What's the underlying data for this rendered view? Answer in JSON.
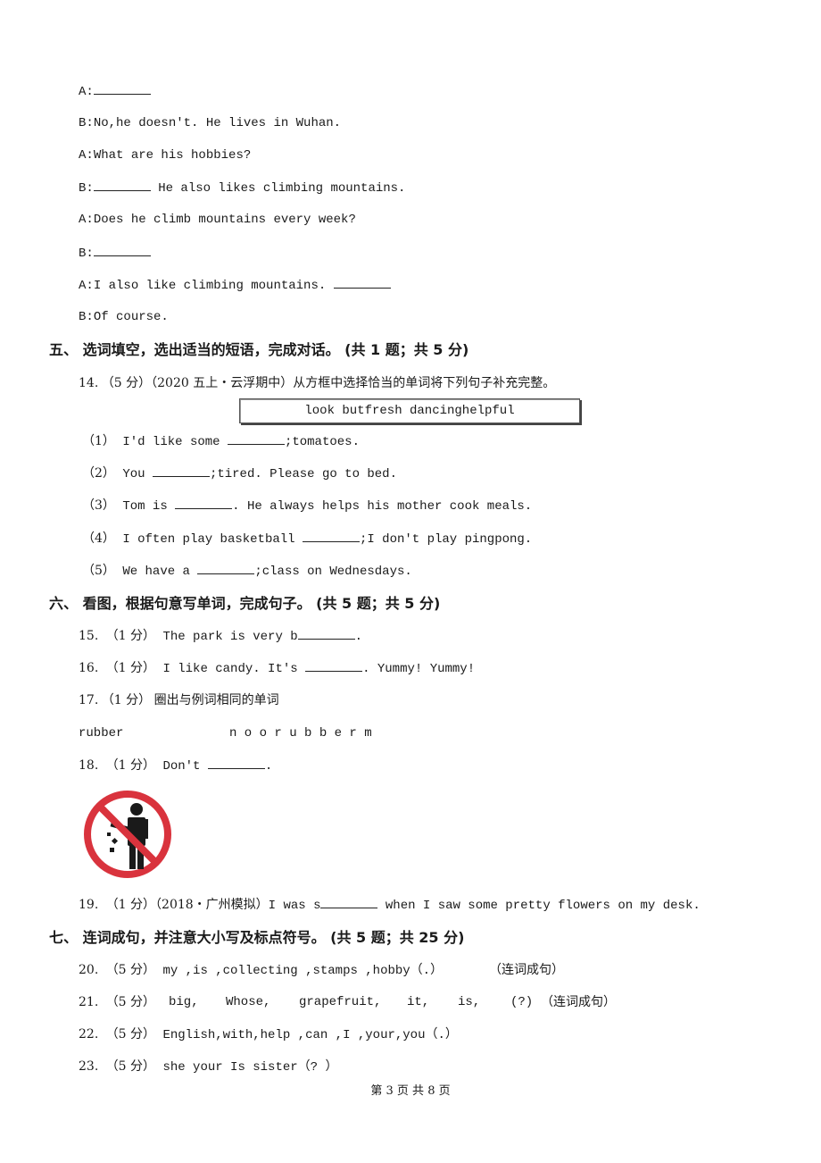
{
  "dialogue": [
    {
      "speaker": "A:",
      "before": "",
      "blank": true,
      "after": ""
    },
    {
      "speaker": "B:",
      "before": "No,he doesn't. He lives in Wuhan.",
      "blank": false,
      "after": ""
    },
    {
      "speaker": "A:",
      "before": "What are his hobbies?",
      "blank": false,
      "after": ""
    },
    {
      "speaker": "B:",
      "before": "",
      "blank": true,
      "after": " He also likes climbing mountains."
    },
    {
      "speaker": "A:",
      "before": "Does he climb mountains every week?",
      "blank": false,
      "after": ""
    },
    {
      "speaker": "B:",
      "before": "",
      "blank": true,
      "after": ""
    },
    {
      "speaker": "A:",
      "before": "I also like climbing mountains. ",
      "blank": true,
      "after": ""
    },
    {
      "speaker": "B:",
      "before": "Of course.",
      "blank": false,
      "after": ""
    }
  ],
  "section5": {
    "title": "五、 选词填空，选出适当的短语，完成对话。 (共 1 题；共 5 分)",
    "q14": {
      "num": "14.",
      "score": "（5 分）",
      "source": "（2020 五上・云浮期中）",
      "instruction": "从方框中选择恰当的单词将下列句子补充完整。",
      "word_box": "look butfresh dancinghelpful",
      "items": [
        {
          "label": "（1）",
          "before": "I'd like some ",
          "after": ";tomatoes."
        },
        {
          "label": "（2）",
          "before": "You ",
          "after": ";tired. Please go to bed."
        },
        {
          "label": "（3）",
          "before": "Tom is ",
          "after": ". He always helps his mother cook meals."
        },
        {
          "label": "（4）",
          "before": "I often play basketball ",
          "after": ";I don't play pingpong."
        },
        {
          "label": "（5）",
          "before": "We have a ",
          "after": ";class on Wednesdays."
        }
      ]
    }
  },
  "section6": {
    "title": "六、 看图，根据句意写单词，完成句子。 (共 5 题；共 5 分)",
    "q15": {
      "num": "15.",
      "score": "（1 分）",
      "before": "The park is very b",
      "after": "."
    },
    "q16": {
      "num": "16.",
      "score": "（1 分）",
      "before": "I like candy. It's ",
      "after": ". Yummy! Yummy!"
    },
    "q17": {
      "num": "17.",
      "score": "（1 分）",
      "text": "圈出与例词相同的单词",
      "example": "rubber",
      "letters": "n o o r u b b e r m"
    },
    "q18": {
      "num": "18.",
      "score": "（1 分）",
      "before": "Don't ",
      "after": ".",
      "image": "no-littering-sign"
    },
    "q19": {
      "num": "19.",
      "score": "（1 分）",
      "source": "（2018・广州模拟）",
      "before": "I was s",
      "after": " when I saw some pretty flowers on my desk."
    }
  },
  "section7": {
    "title": "七、 连词成句，并注意大小写及标点符号。 (共 5 题；共 25 分)",
    "q20": {
      "num": "20.",
      "score": "（5 分）",
      "text": "my ,is ,collecting ,stamps ,hobby（.）",
      "hint": "（连词成句）"
    },
    "q21": {
      "num": "21.",
      "score": "（5 分）",
      "words": [
        "big,",
        "Whose,",
        "grapefruit,",
        "it,",
        "is,",
        "(?)"
      ],
      "hint": "（连词成句）"
    },
    "q22": {
      "num": "22.",
      "score": "（5 分）",
      "text": "English,with,help ,can ,I ,your,you（.）"
    },
    "q23": {
      "num": "23.",
      "score": "（5 分）",
      "text": "she your Is sister（? ）"
    }
  },
  "footer": "第 3 页 共 8 页",
  "colors": {
    "sign_red": "#d9333d",
    "figure": "#1a1a1a"
  }
}
